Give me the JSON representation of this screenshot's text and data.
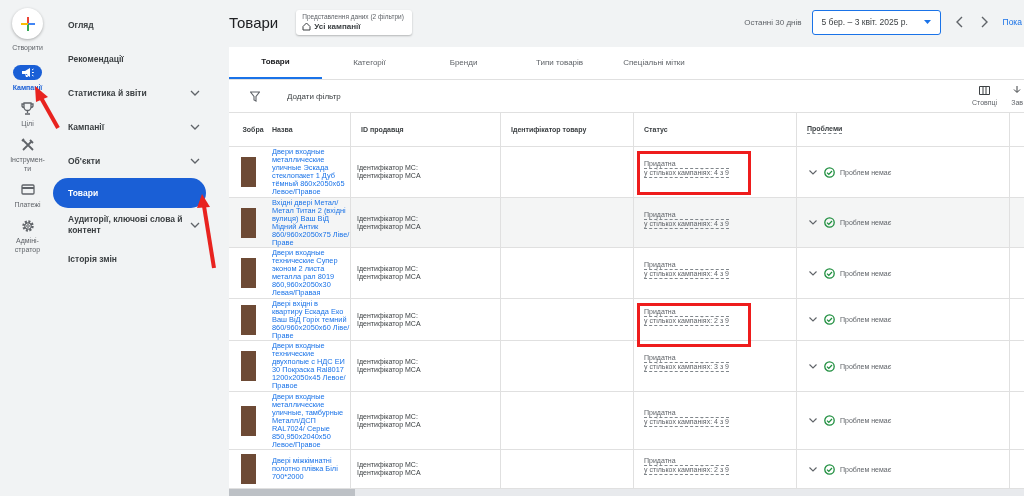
{
  "rail": {
    "create_label": "Створити",
    "items": [
      {
        "kind": "megaphone",
        "label": "Кампанії",
        "selected": true
      },
      {
        "kind": "trophy",
        "label": "Цілі",
        "selected": false
      },
      {
        "kind": "tools",
        "label": "Інструмен-\nти",
        "selected": false
      },
      {
        "kind": "card",
        "label": "Платежі",
        "selected": false
      },
      {
        "kind": "gear",
        "label": "Адміні-\nстратор",
        "selected": false
      }
    ]
  },
  "nav": [
    {
      "label": "Огляд",
      "expandable": false,
      "selected": false
    },
    {
      "label": "Рекомендації",
      "expandable": false,
      "selected": false
    },
    {
      "label": "Статистика й звіти",
      "expandable": true,
      "selected": false
    },
    {
      "label": "Кампанії",
      "expandable": true,
      "selected": false
    },
    {
      "label": "Об'єкти",
      "expandable": true,
      "selected": false
    },
    {
      "label": "Товари",
      "expandable": false,
      "selected": true
    },
    {
      "label": "Аудиторії, ключові слова й контент",
      "expandable": true,
      "selected": false
    },
    {
      "label": "Історія змін",
      "expandable": false,
      "selected": false
    }
  ],
  "page_title": "Товари",
  "view_filter": {
    "caption": "Представлення даних (2 фільтри)",
    "value": "Усі кампанії"
  },
  "date": {
    "preset": "Останні 30 днів",
    "range": "5 бер. – 3 квіт. 2025 р."
  },
  "show_link": "Пока",
  "tabs": [
    {
      "label": "Товари",
      "selected": true
    },
    {
      "label": "Категорії",
      "selected": false
    },
    {
      "label": "Бренди",
      "selected": false
    },
    {
      "label": "Типи товарів",
      "selected": false
    },
    {
      "label": "Спеціальні мітки",
      "selected": false
    }
  ],
  "toolbar": {
    "add_filter": "Додати фільтр",
    "columns": "Стовпці",
    "more": "Зав"
  },
  "columns": [
    "Зобра",
    "Назва",
    "ID продавця",
    "Ідентифікатор товару",
    "Статус",
    "Проблеми"
  ],
  "rows": [
    {
      "name": "Двери входные металлические уличные Эскада стеклопакет 1 Дуб тёмный 860х2050х65 Левое/Правое",
      "seller_id": [
        "Ідентифікатор MC:",
        "Ідентифікатор MCA"
      ],
      "status": "Придатна",
      "status_detail": "у стількох кампаніях: 4 з 9",
      "issues": "Проблем немає",
      "hovered": false,
      "highlighted": true
    },
    {
      "name": "Вхідні двері Метал/Метал Титан 2 (вхідні вулиця) Ваш ВіД Мідний Антик 860/960х2050х75 Ліве/Праве",
      "seller_id": [
        "Ідентифікатор MC:",
        "Ідентифікатор MCA"
      ],
      "status": "Придатна",
      "status_detail": "у стількох кампаніях: 4 з 9",
      "issues": "Проблем немає",
      "hovered": true,
      "highlighted": false
    },
    {
      "name": "Двери входные технические Супер эконом 2 листа металла рал 8019 860,960х2050х30 Левая/Правая",
      "seller_id": [
        "Ідентифікатор MC:",
        "Ідентифікатор MCA"
      ],
      "status": "Придатна",
      "status_detail": "у стількох кампаніях: 4 з 9",
      "issues": "Проблем немає",
      "hovered": false,
      "highlighted": false
    },
    {
      "name": "Двері вхідні в квартиру Ескада Еко Ваш ВіД Горіх темний 860/960х2050х60 Ліве/Праве",
      "seller_id": [
        "Ідентифікатор MC:",
        "Ідентифікатор MCA"
      ],
      "status": "Придатна",
      "status_detail": "у стількох кампаніях: 2 з 9",
      "issues": "Проблем немає",
      "hovered": false,
      "highlighted": true
    },
    {
      "name": "Двери входные технические двухполые с НДС ЕИ 30 Покраска Ral8017 1200х2050х45 Левое/Правое",
      "seller_id": [
        "Ідентифікатор MC:",
        "Ідентифікатор MCA"
      ],
      "status": "Придатна",
      "status_detail": "у стількох кампаніях: 3 з 9",
      "issues": "Проблем немає",
      "hovered": false,
      "highlighted": false
    },
    {
      "name": "Двери входные металлические уличные, тамбурные Металл/ДСП RAL7024/ Серые 850,950х2040х50 Левое/Правое",
      "seller_id": [
        "Ідентифікатор MC:",
        "Ідентифікатор MCA"
      ],
      "status": "Придатна",
      "status_detail": "у стількох кампаніях: 4 з 9",
      "issues": "Проблем немає",
      "hovered": false,
      "highlighted": false
    },
    {
      "name": "Двері міжкімнатні полотно плівка Білі 700*2000",
      "seller_id": [
        "Ідентифікатор MC:",
        "Ідентифікатор MCA"
      ],
      "status": "Придатна",
      "status_detail": "у стількох кампаніях: 2 з 9",
      "issues": "Проблем немає",
      "hovered": false,
      "highlighted": false
    }
  ]
}
